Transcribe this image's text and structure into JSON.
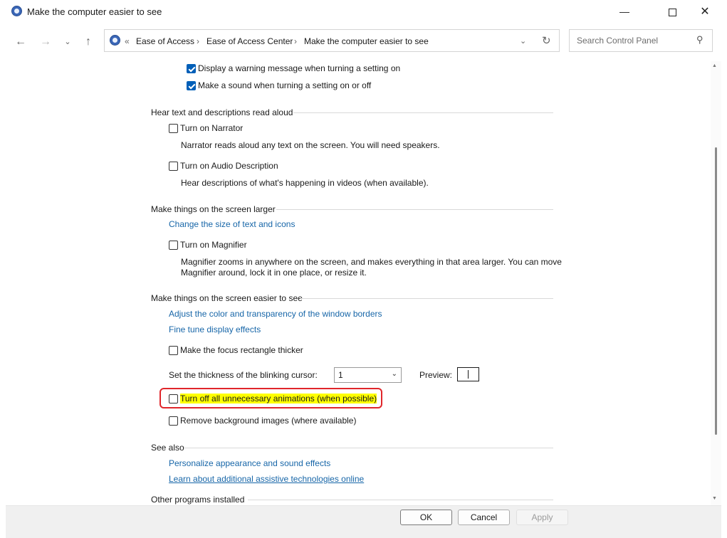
{
  "window": {
    "title": "Make the computer easier to see",
    "minimize_icon": "minimize-icon",
    "maximize_icon": "maximize-icon",
    "close_icon": "close-icon"
  },
  "nav": {
    "back_icon": "arrow-left-icon",
    "forward_icon": "arrow-right-icon",
    "recent_icon": "chevron-down-icon",
    "up_icon": "arrow-up-icon",
    "overflow": "«",
    "breadcrumbs": [
      "Ease of Access",
      "Ease of Access Center",
      "Make the computer easier to see"
    ],
    "separator": "›",
    "dropdown_icon": "chevron-down-icon",
    "refresh_icon": "refresh-icon",
    "search_placeholder": "Search Control Panel",
    "search_icon": "search-icon"
  },
  "top_checks": [
    {
      "label": "Display a warning message when turning a setting on",
      "checked": true
    },
    {
      "label": "Make a sound when turning a setting on or off",
      "checked": true
    }
  ],
  "hear": {
    "heading": "Hear text and descriptions read aloud",
    "narrator_label": "Turn on Narrator",
    "narrator_desc": "Narrator reads aloud any text on the screen. You will need speakers.",
    "audio_label": "Turn on Audio Description",
    "audio_desc": "Hear descriptions of what's happening in videos (when available)."
  },
  "larger": {
    "heading": "Make things on the screen larger",
    "link_text_size": "Change the size of text and icons",
    "magnifier_label": "Turn on Magnifier",
    "magnifier_desc_line1": "Magnifier zooms in anywhere on the screen, and makes everything in that area larger. You can move",
    "magnifier_desc_line2": "Magnifier around, lock it in one place, or resize it."
  },
  "easier": {
    "heading": "Make things on the screen easier to see",
    "link_color": "Adjust the color and transparency of the window borders",
    "link_effects": "Fine tune display effects",
    "focus_label": "Make the focus rectangle thicker",
    "cursor_label": "Set the thickness of the blinking cursor:",
    "cursor_value": "1",
    "preview_label": "Preview:",
    "animations_label": "Turn off all unnecessary animations (when possible)",
    "background_label": "Remove background images (where available)"
  },
  "see_also": {
    "heading": "See also",
    "link_personalize": "Personalize appearance and sound effects",
    "link_learn": "Learn about additional assistive technologies online"
  },
  "other": {
    "heading": "Other programs installed"
  },
  "footer": {
    "ok": "OK",
    "cancel": "Cancel",
    "apply": "Apply"
  },
  "colors": {
    "link": "#1766a8",
    "check_accent": "#005fb8",
    "highlight": "#ffff00",
    "annotation_red": "#e0262b"
  }
}
